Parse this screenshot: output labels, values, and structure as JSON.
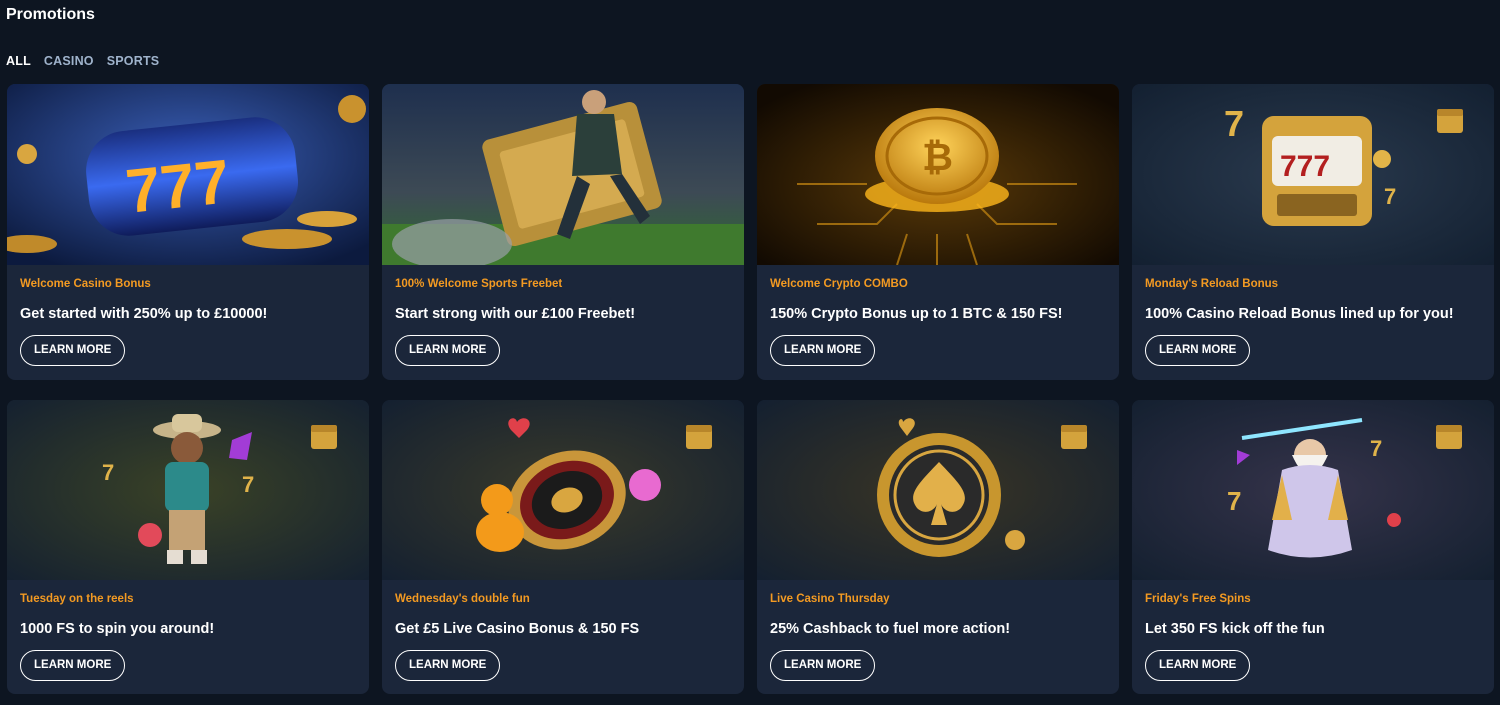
{
  "page": {
    "title": "Promotions"
  },
  "tabs": [
    {
      "label": "ALL",
      "active": true
    },
    {
      "label": "CASINO",
      "active": false
    },
    {
      "label": "SPORTS",
      "active": false
    }
  ],
  "promotions": [
    {
      "category": "Welcome Casino Bonus",
      "headline": "Get started with 250% up to £10000!",
      "button": "LEARN MORE",
      "image": "slot-reels-777"
    },
    {
      "category": "100% Welcome Sports Freebet",
      "headline": "Start strong with our £100 Freebet!",
      "button": "LEARN MORE",
      "image": "football-player-ticket"
    },
    {
      "category": "Welcome Crypto COMBO",
      "headline": "150% Crypto Bonus up to 1 BTC & 150 FS!",
      "button": "LEARN MORE",
      "image": "golden-bitcoin"
    },
    {
      "category": "Monday's Reload Bonus",
      "headline": "100% Casino Reload Bonus lined up for you!",
      "button": "LEARN MORE",
      "image": "slot-machine-calendar"
    },
    {
      "category": "Tuesday on the reels",
      "headline": "1000 FS to spin you around!",
      "button": "LEARN MORE",
      "image": "cowboy-character-calendar"
    },
    {
      "category": "Wednesday's double fun",
      "headline": "Get £5 Live Casino Bonus & 150 FS",
      "button": "LEARN MORE",
      "image": "roulette-bear-calendar"
    },
    {
      "category": "Live Casino Thursday",
      "headline": "25% Cashback to fuel more action!",
      "button": "LEARN MORE",
      "image": "spade-chip-calendar"
    },
    {
      "category": "Friday's Free Spins",
      "headline": "Let 350 FS kick off the fun",
      "button": "LEARN MORE",
      "image": "zeus-character-calendar"
    }
  ],
  "colors": {
    "background": "#0d1521",
    "card": "#1b263a",
    "accent": "#f39a22",
    "tab_inactive": "#9fb3cc"
  }
}
